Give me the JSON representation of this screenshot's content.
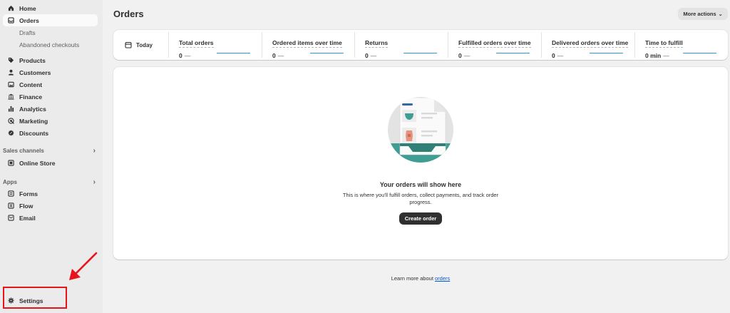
{
  "sidebar": {
    "nav": [
      {
        "label": "Home",
        "icon": "home-icon"
      },
      {
        "label": "Orders",
        "icon": "inbox-icon"
      }
    ],
    "orders_sub": [
      "Drafts",
      "Abandoned checkouts"
    ],
    "nav2": [
      {
        "label": "Products",
        "icon": "tag-icon"
      },
      {
        "label": "Customers",
        "icon": "person-icon"
      },
      {
        "label": "Content",
        "icon": "image-icon"
      },
      {
        "label": "Finance",
        "icon": "bank-icon"
      },
      {
        "label": "Analytics",
        "icon": "bar-chart-icon"
      },
      {
        "label": "Marketing",
        "icon": "target-icon"
      },
      {
        "label": "Discounts",
        "icon": "discount-icon"
      }
    ],
    "sales_channels_label": "Sales channels",
    "online_store": "Online Store",
    "apps_label": "Apps",
    "apps": [
      {
        "label": "Forms",
        "icon": "form-icon"
      },
      {
        "label": "Flow",
        "icon": "flow-icon"
      },
      {
        "label": "Email",
        "icon": "email-icon"
      }
    ],
    "settings": "Settings"
  },
  "header": {
    "title": "Orders",
    "more_actions": "More actions"
  },
  "stats": {
    "period": "Today",
    "items": [
      {
        "title": "Total orders",
        "value": "0",
        "dash": "—"
      },
      {
        "title": "Ordered items over time",
        "value": "0",
        "dash": "—"
      },
      {
        "title": "Returns",
        "value": "0",
        "dash": "—"
      },
      {
        "title": "Fulfilled orders over time",
        "value": "0",
        "dash": "—"
      },
      {
        "title": "Delivered orders over time",
        "value": "0",
        "dash": "—"
      },
      {
        "title": "Time to fulfill",
        "value": "0 min",
        "dash": "—"
      }
    ]
  },
  "empty_state": {
    "title": "Your orders will show here",
    "description": "This is where you'll fulfill orders, collect payments, and track order progress.",
    "button": "Create order"
  },
  "footer": {
    "learn_text": "Learn more about",
    "learn_link": "orders"
  },
  "colors": {
    "accent": "#2c9ad8",
    "annotation": "#e8141b",
    "primary_button": "#303030",
    "link": "#005bd3"
  }
}
